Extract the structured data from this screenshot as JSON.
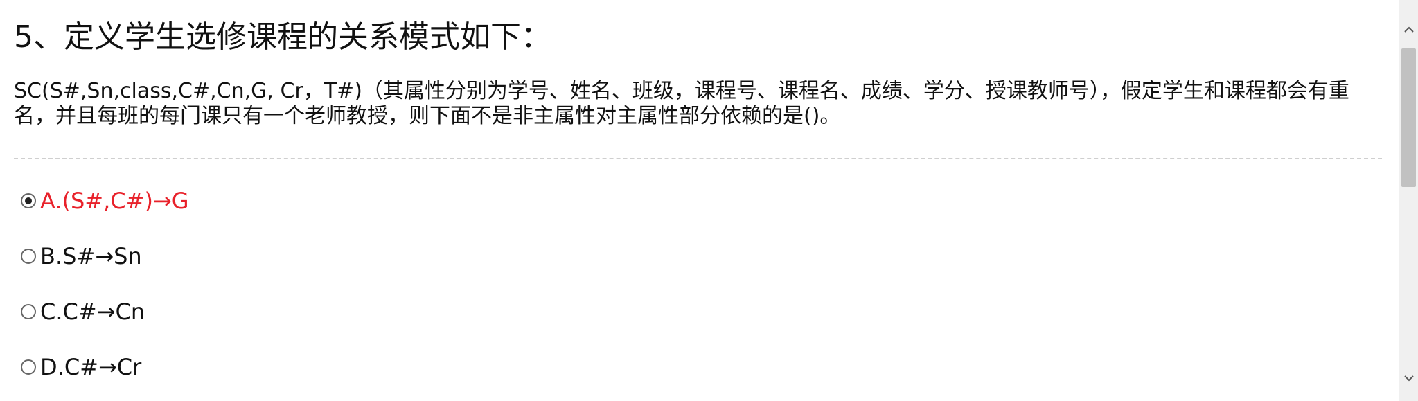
{
  "question": {
    "title": "5、定义学生选修课程的关系模式如下：",
    "body": "SC(S#,Sn,class,C#,Cn,G, Cr，T#)（其属性分别为学号、姓名、班级，课程号、课程名、成绩、学分、授课教师号），假定学生和课程都会有重名，并且每班的每门课只有一个老师教授，则下面不是非主属性对主属性部分依赖的是()。"
  },
  "options": [
    {
      "label": "A.(S#,C#)→G",
      "selected": true
    },
    {
      "label": "B.S#→Sn",
      "selected": false
    },
    {
      "label": "C.C#→Cn",
      "selected": false
    },
    {
      "label": "D.C#→Cr",
      "selected": false
    }
  ],
  "colors": {
    "selected_text": "#e8212a",
    "divider": "#cfcfcf"
  },
  "icons": {
    "scroll_up": "chevron-up-icon",
    "scroll_down": "chevron-down-icon"
  }
}
